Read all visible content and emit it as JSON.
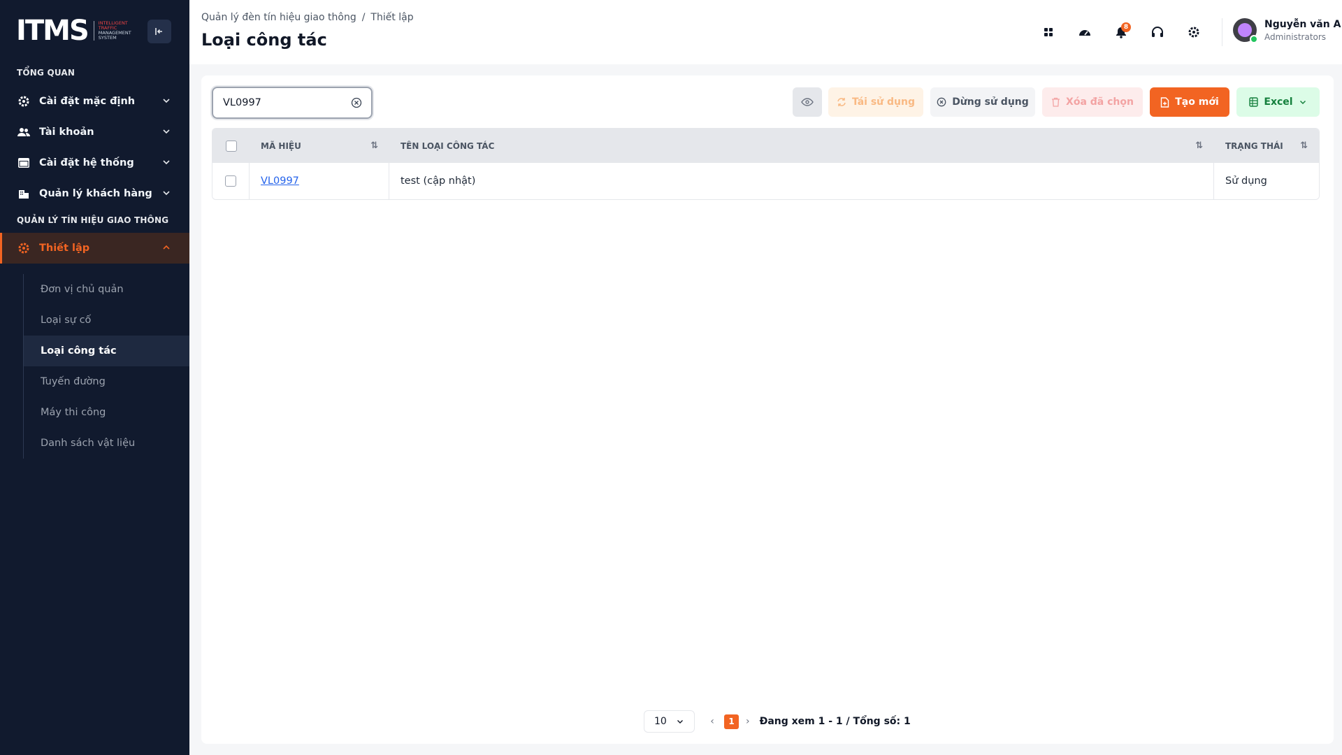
{
  "brand": {
    "logo_main": "ITMS",
    "logo_sub_1": "INTELLIGENT",
    "logo_sub_2": "TRAFFIC",
    "logo_sub_3": "MANAGEMENT",
    "logo_sub_4": "SYSTEM",
    "accent_color": "#f26422"
  },
  "sidebar": {
    "section_overview": "TỔNG QUAN",
    "section_traffic": "QUẢN LÝ TÍN HIỆU GIAO THÔNG",
    "items": [
      {
        "label": "Cài đặt mặc định",
        "icon": "gear-icon"
      },
      {
        "label": "Tài khoản",
        "icon": "users-icon"
      },
      {
        "label": "Cài đặt hệ thống",
        "icon": "window-icon"
      },
      {
        "label": "Quản lý khách hàng",
        "icon": "building-icon"
      },
      {
        "label": "Thiết lập",
        "icon": "gear-icon"
      }
    ],
    "submenu": [
      {
        "label": "Đơn vị chủ quản"
      },
      {
        "label": "Loại sự cố"
      },
      {
        "label": "Loại công tác"
      },
      {
        "label": "Tuyến đường"
      },
      {
        "label": "Máy thi công"
      },
      {
        "label": "Danh sách vật liệu"
      }
    ]
  },
  "header": {
    "breadcrumb": [
      "Quản lý đèn tín hiệu giao thông",
      "/",
      "Thiết lập"
    ],
    "title": "Loại công tác",
    "notification_count": "8",
    "user_name": "Nguyễn văn A",
    "user_role": "Administrators"
  },
  "toolbar": {
    "search_value": "VL0997",
    "reuse_label": "Tái sử dụng",
    "stop_label": "Dừng sử dụng",
    "delete_label": "Xóa đã chọn",
    "new_label": "Tạo mới",
    "excel_label": "Excel"
  },
  "table": {
    "columns": [
      "MÃ HIỆU",
      "TÊN LOẠI CÔNG TÁC",
      "TRẠNG THÁI"
    ],
    "rows": [
      {
        "code": "VL0997",
        "name": "test (cập nhật)",
        "status": "Sử dụng"
      }
    ]
  },
  "pagination": {
    "page_size": "10",
    "current_page": "1",
    "info": "Đang xem 1 - 1 / Tổng số: 1"
  }
}
